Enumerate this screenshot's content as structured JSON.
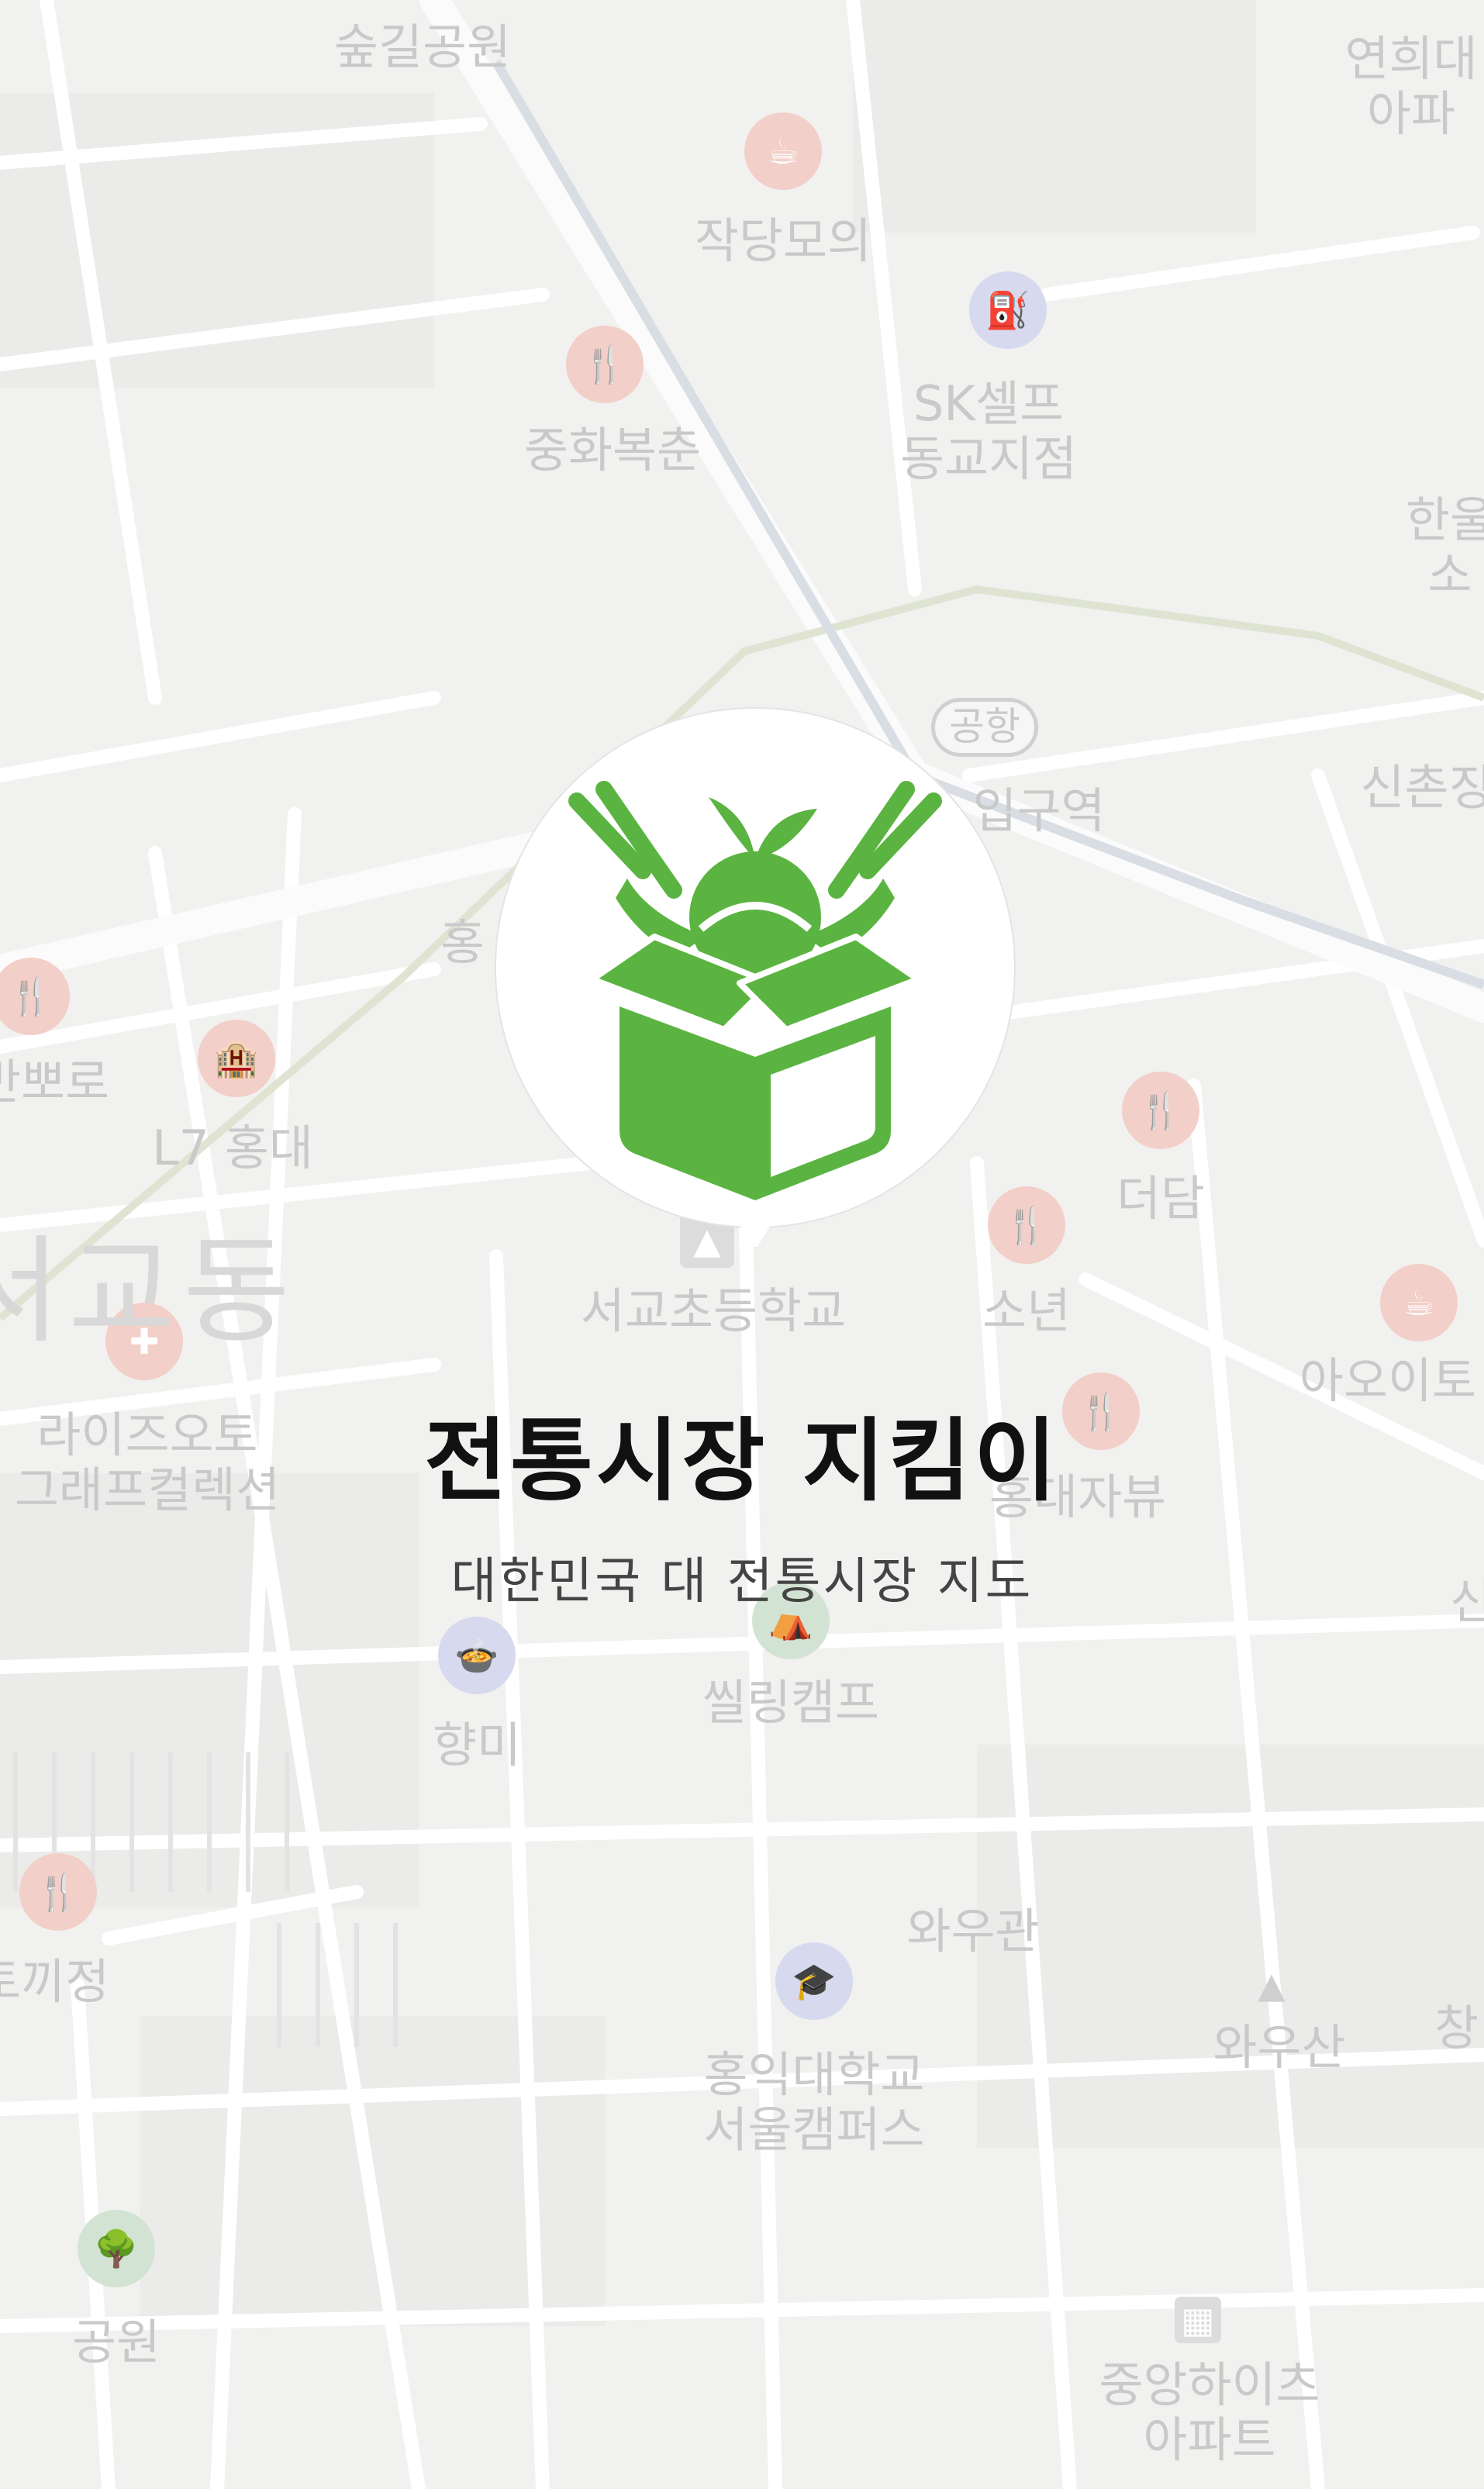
{
  "app": {
    "title": "전통시장 지킴이",
    "subtitle": "대한민국 대 전통시장 지도",
    "accent_color": "#5bb441",
    "logo_icon": "market-box-icon"
  },
  "map": {
    "labels": {
      "park_top": "숲길공원",
      "apt_top_right_1": "연희대",
      "apt_top_right_2": "아파",
      "cafe": "작당모의",
      "sk_1": "SK셀프",
      "sk_2": "동교지점",
      "chinese": "중화복춘",
      "hangul_1": "한울",
      "hangul_2": "소",
      "airport_badge": "공항",
      "station": "입구역",
      "sinchon": "신촌징",
      "hong": "홍",
      "bbo": "반뽀로",
      "l7": "L7 홍대",
      "dong": "서교동",
      "deodam": "더담",
      "school": "서교초등학교",
      "sonyeon": "소년",
      "aoi": "아오이토",
      "rise_1": "라이즈오토",
      "rise_2": "그래프컬렉션",
      "jaebyu": "홍대자뷰",
      "sil": "씰링캠프",
      "hyangmi": "향미",
      "tokki": "토끼정",
      "wawoo_gwan": "와우관",
      "wawoo_san": "와우산",
      "chang": "창",
      "hongik_1": "홍익대학교",
      "hongik_2": "서울캠퍼스",
      "park_bottom": "공원",
      "joongang_1": "중앙하이츠",
      "joongang_2": "아파트",
      "sin_right": "신"
    }
  }
}
